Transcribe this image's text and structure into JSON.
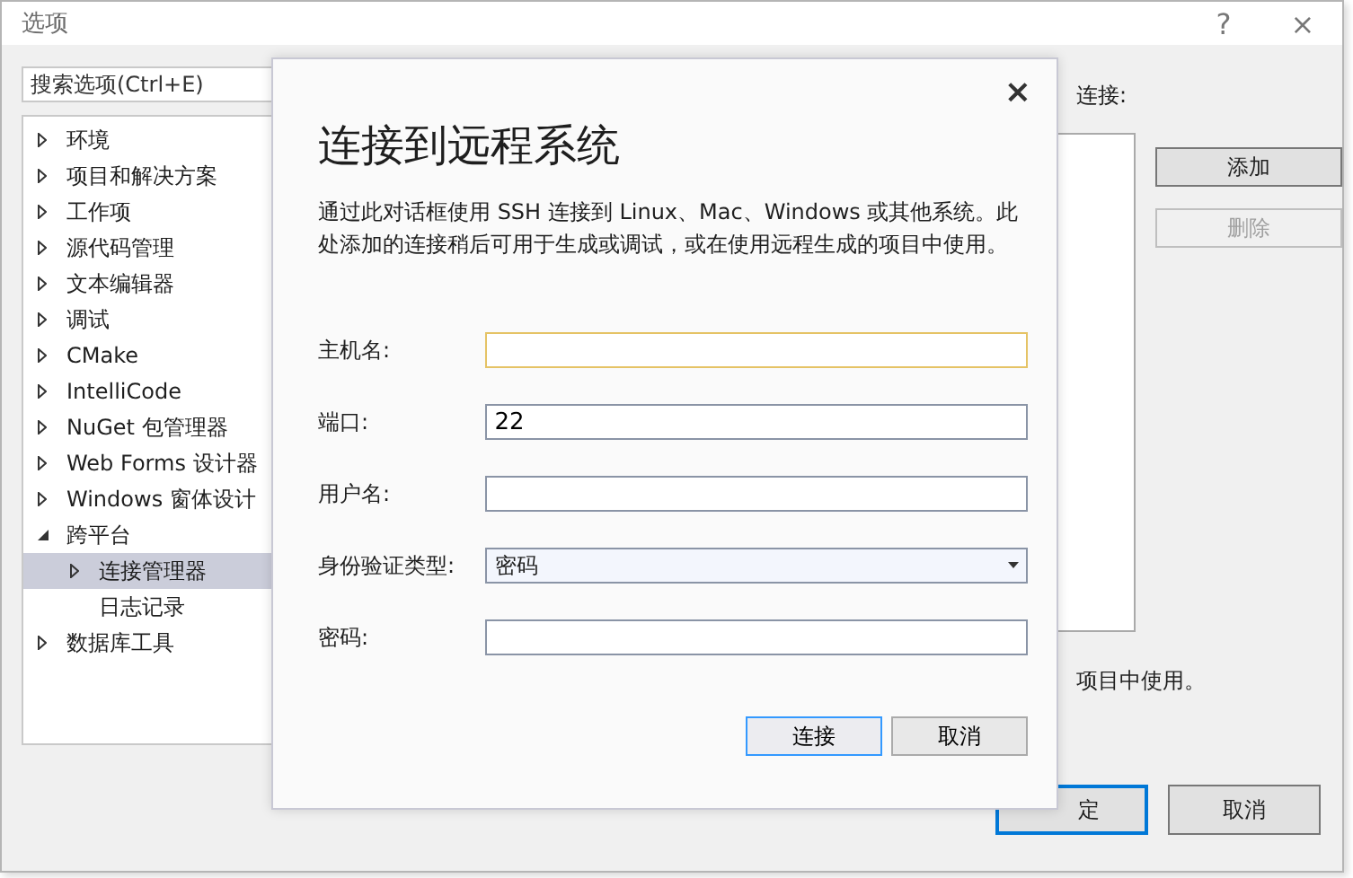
{
  "window": {
    "title": "选项",
    "help": "?",
    "close": "×"
  },
  "search": {
    "placeholder": "搜索选项(Ctrl+E)"
  },
  "tree": [
    {
      "label": "环境",
      "kind": "branch",
      "expanded": false,
      "selected": false
    },
    {
      "label": "项目和解决方案",
      "kind": "branch",
      "expanded": false,
      "selected": false
    },
    {
      "label": "工作项",
      "kind": "branch",
      "expanded": false,
      "selected": false
    },
    {
      "label": "源代码管理",
      "kind": "branch",
      "expanded": false,
      "selected": false
    },
    {
      "label": "文本编辑器",
      "kind": "branch",
      "expanded": false,
      "selected": false
    },
    {
      "label": "调试",
      "kind": "branch",
      "expanded": false,
      "selected": false
    },
    {
      "label": "CMake",
      "kind": "branch",
      "expanded": false,
      "selected": false
    },
    {
      "label": "IntelliCode",
      "kind": "branch",
      "expanded": false,
      "selected": false
    },
    {
      "label": "NuGet 包管理器",
      "kind": "branch",
      "expanded": false,
      "selected": false
    },
    {
      "label": "Web Forms 设计器",
      "kind": "branch",
      "expanded": false,
      "selected": false
    },
    {
      "label": "Windows 窗体设计",
      "kind": "branch",
      "expanded": false,
      "selected": false
    },
    {
      "label": "跨平台",
      "kind": "branch",
      "expanded": true,
      "selected": false,
      "children": [
        {
          "label": "连接管理器",
          "kind": "branch",
          "expanded": false,
          "selected": true
        },
        {
          "label": "日志记录",
          "kind": "leaf",
          "selected": false
        }
      ]
    },
    {
      "label": "数据库工具",
      "kind": "branch",
      "expanded": false,
      "selected": false
    }
  ],
  "page": {
    "connections_label": "连接:",
    "note": "项目中使用。",
    "buttons": [
      {
        "label": "添加",
        "disabled": false
      },
      {
        "label": "删除",
        "disabled": true
      }
    ]
  },
  "footer_buttons": [
    {
      "label": "定",
      "primary": true
    },
    {
      "label": "取消",
      "primary": false
    }
  ],
  "dialog": {
    "close": "×",
    "title": "连接到远程系统",
    "description": "通过此对话框使用 SSH 连接到 Linux、Mac、Windows 或其他系统。此处添加的连接稍后可用于生成或调试，或在使用远程生成的项目中使用。",
    "fields": [
      {
        "label": "主机名:",
        "kind": "text",
        "focused": true
      },
      {
        "label": "端口:",
        "kind": "text",
        "value": "22",
        "focused": false
      },
      {
        "label": "用户名:",
        "kind": "text",
        "focused": false
      },
      {
        "label": "身份验证类型:",
        "kind": "select",
        "value": "密码",
        "focused": false
      },
      {
        "label": "密码:",
        "kind": "text",
        "focused": false
      }
    ],
    "buttons": [
      {
        "label": "连接",
        "primary": true
      },
      {
        "label": "取消",
        "primary": false
      }
    ]
  }
}
